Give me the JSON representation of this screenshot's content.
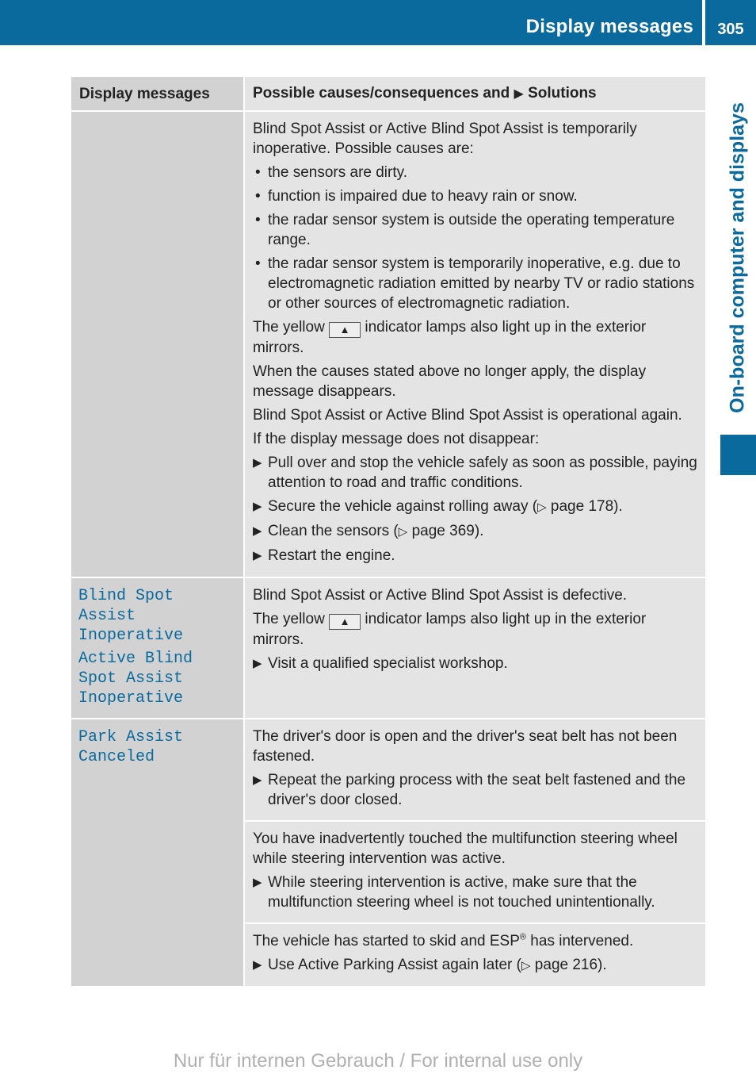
{
  "header": {
    "section_title": "Display messages",
    "page_number": "305",
    "brand_color": "#0b6a9d"
  },
  "side_tab": {
    "label": "On-board computer and displays"
  },
  "table": {
    "columns": {
      "display_messages": "Display messages",
      "causes_prefix": "Possible causes/consequences and",
      "solutions_marker": "▶",
      "solutions_label": "Solutions"
    },
    "row1": {
      "intro": "Blind Spot Assist or Active Blind Spot Assist is temporarily inoperative. Possible causes are:",
      "bullet_marker": "•",
      "causes": [
        "the sensors are dirty.",
        "function is impaired due to heavy rain or snow.",
        "the radar sensor system is outside the operating temperature range.",
        "the radar sensor system is temporarily inoperative, e.g. due to electromagnetic radiation emitted by nearby TV or radio stations or other sources of electromagnetic radiation."
      ],
      "lamp_before": "The yellow",
      "lamp_icon": "▲",
      "lamp_after": "indicator lamps also light up in the exterior mirrors.",
      "note1": "When the causes stated above no longer apply, the display message disappears.",
      "note2": "Blind Spot Assist or Active Blind Spot Assist is operational again.",
      "note3": "If the display message does not disappear:",
      "step_marker": "▶",
      "step1": "Pull over and stop the vehicle safely as soon as possible, paying attention to road and traffic conditions.",
      "step2_text": "Secure the vehicle against rolling away (",
      "step2_ref_icon": "▷",
      "step2_ref": " page 178).",
      "step3_text": "Clean the sensors (",
      "step3_ref_icon": "▷",
      "step3_ref": " page 369).",
      "step4": "Restart the engine."
    },
    "row2": {
      "messages": [
        "Blind Spot Assist Inoperative",
        "Active Blind Spot Assist Inoperative"
      ],
      "text": "Blind Spot Assist or Active Blind Spot Assist is defective.",
      "lamp_before": "The yellow",
      "lamp_icon": "▲",
      "lamp_after": "indicator lamps also light up in the exterior mirrors.",
      "step_marker": "▶",
      "step1": "Visit a qualified specialist workshop."
    },
    "row3": {
      "message": "Park Assist Canceled",
      "a_text": "The driver's door is open and the driver's seat belt has not been fastened.",
      "a_step": "Repeat the parking process with the seat belt fastened and the driver's door closed.",
      "b_text": "You have inadvertently touched the multifunction steering wheel while steering intervention was active.",
      "b_step": "While steering intervention is active, make sure that the multifunction steering wheel is not touched unintentionally.",
      "c_text_before": "The vehicle has started to skid and ESP",
      "c_sup": "®",
      "c_text_after": " has intervened.",
      "c_step_text": "Use Active Parking Assist again later (",
      "c_step_ref_icon": "▷",
      "c_step_ref": " page 216).",
      "step_marker": "▶"
    }
  },
  "footer": {
    "watermark": "Nur für internen Gebrauch / For internal use only"
  }
}
